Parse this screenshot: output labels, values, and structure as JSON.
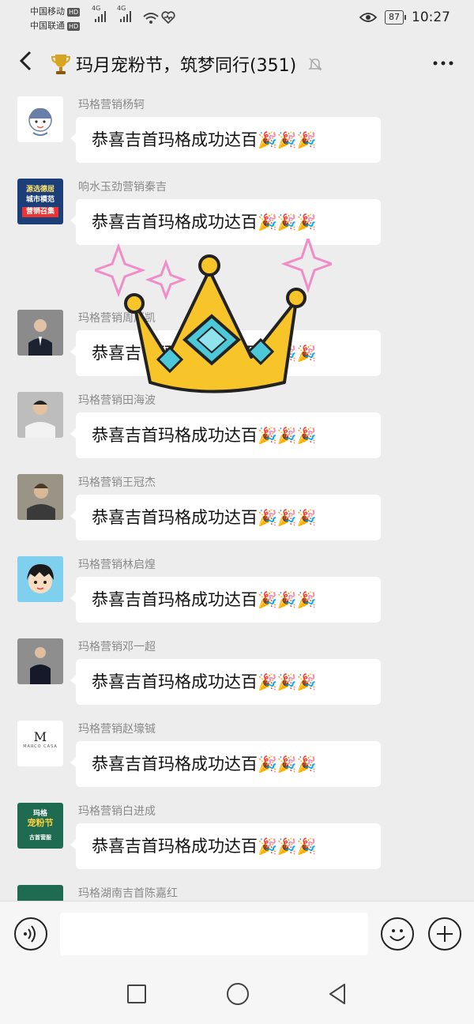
{
  "status": {
    "carrier1": "中国移动",
    "carrier2": "中国联通",
    "hd": "HD",
    "network": "4G",
    "battery": "87",
    "time": "10:27"
  },
  "header": {
    "title": "玛月宠粉节，筑梦同行(351)"
  },
  "messages": [
    {
      "sender": "玛格营销杨轲",
      "text": "恭喜吉首玛格成功达百"
    },
    {
      "sender": "响水玉劲营销秦吉",
      "text": "恭喜吉首玛格成功达百"
    },
    {
      "sender": "玛格营销周厚凯",
      "text": "恭喜吉首玛格成功达百"
    },
    {
      "sender": "玛格营销田海波",
      "text": "恭喜吉首玛格成功达百"
    },
    {
      "sender": "玛格营销王冠杰",
      "text": "恭喜吉首玛格成功达百"
    },
    {
      "sender": "玛格营销林启煌",
      "text": "恭喜吉首玛格成功达百"
    },
    {
      "sender": "玛格营销邓一超",
      "text": "恭喜吉首玛格成功达百"
    },
    {
      "sender": "玛格营销赵壕铖",
      "text": "恭喜吉首玛格成功达百"
    },
    {
      "sender": "玛格营销白进成",
      "text": "恭喜吉首玛格成功达百"
    },
    {
      "sender": "玛格湖南吉首陈嘉红",
      "text": ""
    }
  ],
  "avatar_texts": {
    "a2_line1": "源选德居",
    "a2_line2": "城市模范",
    "a2_line3": "营销召集",
    "a8": "M",
    "a8_sub": "MARCO CASA",
    "a9_line1": "玛格",
    "a9_line2": "宠粉节",
    "a9_line3": "古首营服"
  },
  "colors": {
    "background": "#ededed",
    "bubble": "#ffffff",
    "crown": "#f7c52a",
    "gem": "#4cc8d8"
  }
}
